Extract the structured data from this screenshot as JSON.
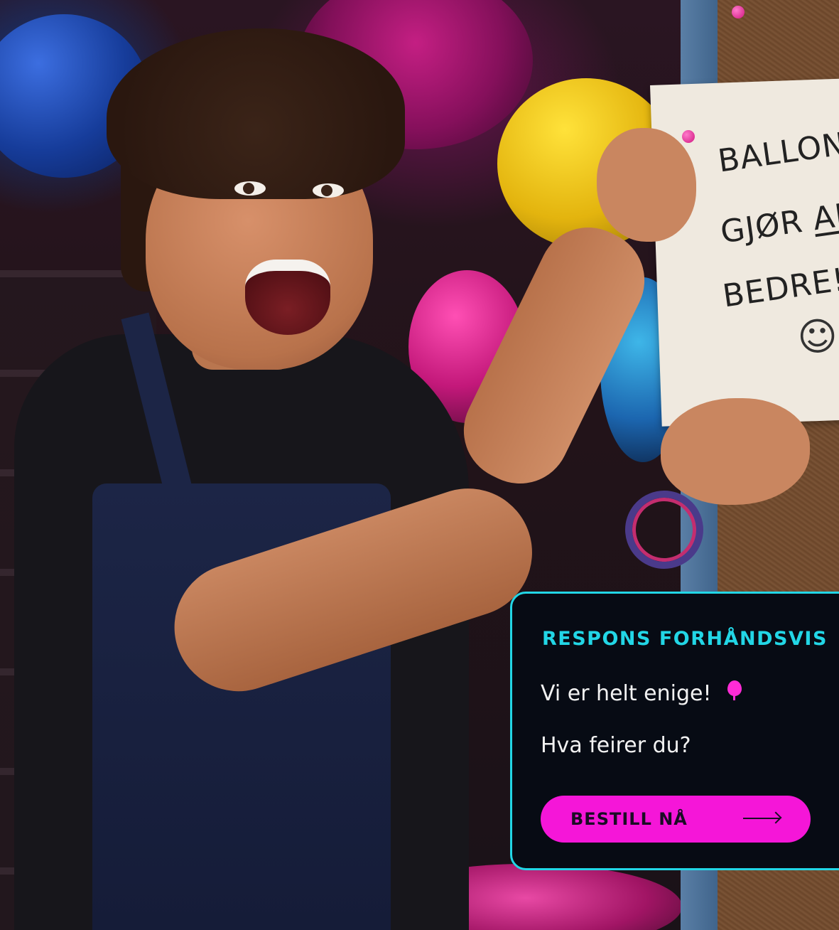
{
  "photo": {
    "sign_text": {
      "line1": "BALLONGE",
      "line2_prefix": "GJØR ",
      "line2_underlined": "AL",
      "line3": "BEDRE!",
      "smiley": "☺"
    }
  },
  "preview_card": {
    "title": "RESPONS FORHÅNDSVIS",
    "message_line1": "Vi er helt enige!",
    "message_line2": "Hva feirer du?",
    "cta_label": "BESTILL NÅ",
    "balloon_icon": "balloon-icon",
    "arrow_icon": "arrow-right-icon"
  },
  "colors": {
    "accent_cyan": "#22d6e6",
    "accent_magenta": "#f516d8",
    "card_background": "#070b14"
  }
}
